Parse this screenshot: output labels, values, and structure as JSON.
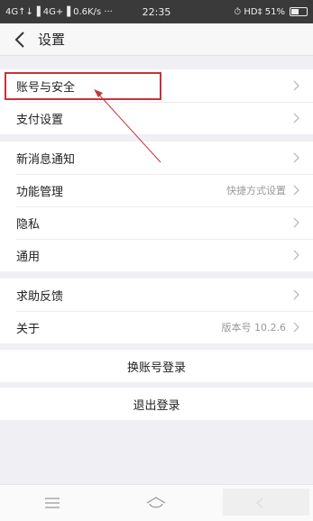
{
  "status_bar": {
    "left": "4G↑↓▐ 4G+▐ 0.6K/s ···",
    "time": "22:35",
    "right": "⏱ HD‡ 51%"
  },
  "header": {
    "title": "设置"
  },
  "groups": [
    {
      "items": [
        {
          "label": "账号与安全"
        },
        {
          "label": "支付设置"
        }
      ]
    },
    {
      "items": [
        {
          "label": "新消息通知"
        },
        {
          "label": "功能管理",
          "value": "快捷方式设置"
        },
        {
          "label": "隐私"
        },
        {
          "label": "通用"
        }
      ]
    },
    {
      "items": [
        {
          "label": "求助反馈"
        },
        {
          "label": "关于",
          "value": "版本号 10.2.6"
        }
      ]
    }
  ],
  "buttons": {
    "switch_account": "换账号登录",
    "logout": "退出登录"
  },
  "colors": {
    "annotation": "#c8333a",
    "background": "#efeff4",
    "row_bg": "#ffffff"
  }
}
